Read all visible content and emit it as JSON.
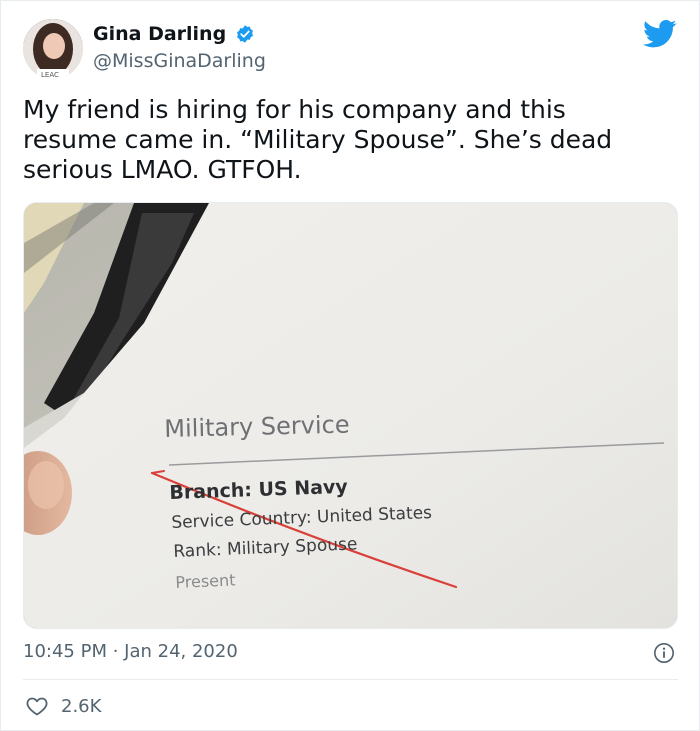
{
  "author": {
    "name": "Gina Darling",
    "handle": "@MissGinaDarling",
    "avatar_caption": "LEAC",
    "verified_icon": "verified-badge-icon"
  },
  "tweet": {
    "text": "My friend is hiring for his company and this\nresume came in. “Military Spouse”. She’s dead\nserious LMAO.  GTFOH."
  },
  "photo": {
    "heading": "Military Service",
    "branch": "Branch: US Navy",
    "service_country": "Service Country: United States",
    "rank": "Rank: Military Spouse",
    "present": "Present"
  },
  "meta": {
    "timestamp": "10:45 PM · Jan 24, 2020",
    "likes": "2.6K"
  },
  "colors": {
    "twitter_blue": "#1d9bf0",
    "secondary_text": "#536471",
    "strike_red": "#d9403a"
  }
}
